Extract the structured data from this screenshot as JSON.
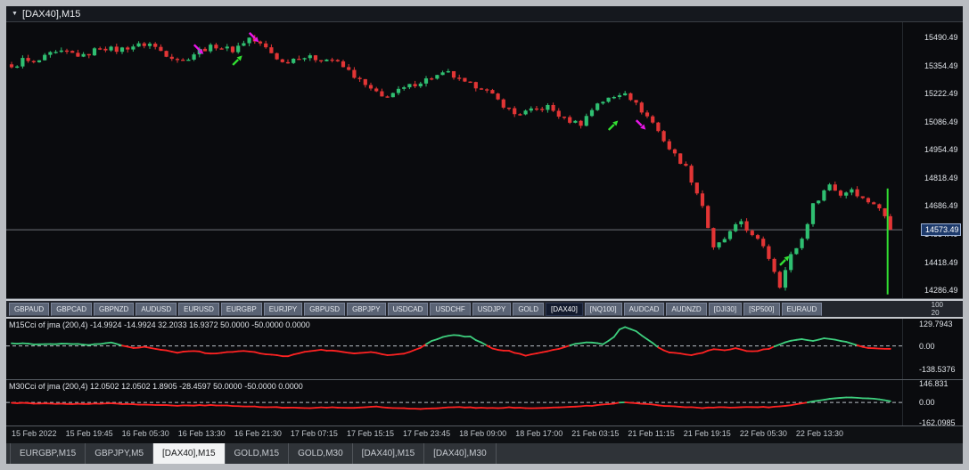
{
  "window": {
    "title": "[DAX40],M15"
  },
  "main_chart": {
    "price_labels": [
      "15490.49",
      "15354.49",
      "15222.49",
      "15086.49",
      "14954.49",
      "14818.49",
      "14686.49",
      "14554.49",
      "14418.49",
      "14286.49"
    ],
    "current_price": "14573.49"
  },
  "symbol_tabs": {
    "items": [
      "GBPAUD",
      "GBPCAD",
      "GBPNZD",
      "AUDUSD",
      "EURUSD",
      "EURGBP",
      "EURJPY",
      "GBPUSD",
      "GBPJPY",
      "USDCAD",
      "USDCHF",
      "USDJPY",
      "GOLD",
      "[DAX40]",
      "[NQ100]",
      "AUDCAD",
      "AUDNZD",
      "[DJI30]",
      "[SP500]",
      "EURAUD"
    ],
    "active": "[DAX40]",
    "right_labels": [
      "100",
      "20"
    ]
  },
  "indicator1": {
    "label": "M15Cci of jma (200,4) -14.9924 -14.9924 32.2033 16.9372 50.0000 -50.0000 0.0000",
    "axis": [
      "129.7943",
      "0.00",
      "-138.5376"
    ]
  },
  "indicator2": {
    "label": "M30Cci of jma (200,4) 12.0502 12.0502 1.8905 -28.4597 50.0000 -50.0000 0.0000",
    "axis": [
      "146.831",
      "0.00",
      "-162.0985"
    ]
  },
  "time_axis": {
    "labels": [
      "15 Feb 2022",
      "15 Feb 19:45",
      "16 Feb 05:30",
      "16 Feb 13:30",
      "16 Feb 21:30",
      "17 Feb 07:15",
      "17 Feb 15:15",
      "17 Feb 23:45",
      "18 Feb 09:00",
      "18 Feb 17:00",
      "21 Feb 03:15",
      "21 Feb 11:15",
      "21 Feb 19:15",
      "22 Feb 05:30",
      "22 Feb 13:30"
    ]
  },
  "bottom_tabs": {
    "items": [
      "EURGBP,M15",
      "GBPJPY,M5",
      "[DAX40],M15",
      "GOLD,M15",
      "GOLD,M30",
      "[DAX40],M15",
      "[DAX40],M30"
    ],
    "active_index": 2
  },
  "colors": {
    "candle_up": "#2fbf71",
    "candle_down": "#e23535",
    "arrow_up": "#32e032",
    "arrow_down": "#e816e8",
    "cci_up": "#3ecf7e",
    "cci_down": "#ff2222",
    "price_line": "#6f747a",
    "zero_line": "#b9bfc6"
  },
  "chart_data": {
    "type": "candlestick",
    "title": "[DAX40],M15",
    "main": {
      "num_candles": 160,
      "ylim": [
        14247,
        15563
      ],
      "current_price": 14573.49,
      "price_keypoints": [
        [
          0,
          15340
        ],
        [
          2,
          15385
        ],
        [
          4,
          15365
        ],
        [
          7,
          15410
        ],
        [
          10,
          15420
        ],
        [
          13,
          15400
        ],
        [
          16,
          15445
        ],
        [
          19,
          15430
        ],
        [
          22,
          15450
        ],
        [
          25,
          15460
        ],
        [
          28,
          15410
        ],
        [
          31,
          15380
        ],
        [
          34,
          15430
        ],
        [
          37,
          15450
        ],
        [
          40,
          15430
        ],
        [
          43,
          15488
        ],
        [
          46,
          15440
        ],
        [
          49,
          15370
        ],
        [
          52,
          15400
        ],
        [
          55,
          15390
        ],
        [
          58,
          15385
        ],
        [
          61,
          15330
        ],
        [
          64,
          15260
        ],
        [
          67,
          15205
        ],
        [
          70,
          15235
        ],
        [
          73,
          15270
        ],
        [
          76,
          15300
        ],
        [
          79,
          15320
        ],
        [
          82,
          15270
        ],
        [
          85,
          15255
        ],
        [
          88,
          15190
        ],
        [
          91,
          15125
        ],
        [
          94,
          15140
        ],
        [
          97,
          15160
        ],
        [
          100,
          15100
        ],
        [
          103,
          15080
        ],
        [
          106,
          15180
        ],
        [
          109,
          15205
        ],
        [
          111,
          15235
        ],
        [
          113,
          15170
        ],
        [
          116,
          15085
        ],
        [
          119,
          14960
        ],
        [
          122,
          14870
        ],
        [
          125,
          14690
        ],
        [
          127,
          14480
        ],
        [
          129,
          14530
        ],
        [
          132,
          14615
        ],
        [
          134,
          14540
        ],
        [
          136,
          14500
        ],
        [
          138,
          14380
        ],
        [
          139,
          14310
        ],
        [
          141,
          14450
        ],
        [
          143,
          14530
        ],
        [
          145,
          14690
        ],
        [
          147,
          14760
        ],
        [
          148,
          14790
        ],
        [
          150,
          14740
        ],
        [
          152,
          14770
        ],
        [
          154,
          14720
        ],
        [
          156,
          14700
        ],
        [
          158,
          14640
        ],
        [
          159,
          14573.49
        ]
      ],
      "arrows": [
        {
          "dir": "down",
          "index": 34,
          "price": 15430
        },
        {
          "dir": "up",
          "index": 41,
          "price": 15385
        },
        {
          "dir": "down",
          "index": 44,
          "price": 15487
        },
        {
          "dir": "up",
          "index": 109,
          "price": 15075
        },
        {
          "dir": "down",
          "index": 114,
          "price": 15070
        },
        {
          "dir": "up",
          "index": 140,
          "price": 14430
        }
      ],
      "vline": {
        "index": 158.5,
        "from": 14770,
        "to": 14265
      }
    },
    "cci_m15": {
      "range": [
        160,
        -195
      ],
      "keypoints": [
        [
          0,
          15
        ],
        [
          6,
          10
        ],
        [
          10,
          14
        ],
        [
          14,
          6
        ],
        [
          18,
          18
        ],
        [
          22,
          -12
        ],
        [
          24,
          -4
        ],
        [
          27,
          -22
        ],
        [
          30,
          -38
        ],
        [
          33,
          -28
        ],
        [
          36,
          -46
        ],
        [
          39,
          -38
        ],
        [
          42,
          -28
        ],
        [
          45,
          -42
        ],
        [
          48,
          -56
        ],
        [
          50,
          -60
        ],
        [
          53,
          -34
        ],
        [
          56,
          -24
        ],
        [
          59,
          -28
        ],
        [
          62,
          -44
        ],
        [
          65,
          -38
        ],
        [
          68,
          -52
        ],
        [
          71,
          -46
        ],
        [
          74,
          -10
        ],
        [
          76,
          30
        ],
        [
          78,
          52
        ],
        [
          80,
          62
        ],
        [
          83,
          54
        ],
        [
          85,
          18
        ],
        [
          87,
          -16
        ],
        [
          90,
          -30
        ],
        [
          93,
          -58
        ],
        [
          96,
          -38
        ],
        [
          99,
          -18
        ],
        [
          102,
          12
        ],
        [
          105,
          22
        ],
        [
          107,
          8
        ],
        [
          109,
          55
        ],
        [
          110,
          95
        ],
        [
          111,
          112
        ],
        [
          113,
          88
        ],
        [
          115,
          38
        ],
        [
          117,
          -8
        ],
        [
          119,
          -38
        ],
        [
          121,
          -44
        ],
        [
          123,
          -56
        ],
        [
          125,
          -38
        ],
        [
          127,
          -18
        ],
        [
          129,
          -26
        ],
        [
          131,
          -14
        ],
        [
          133,
          -30
        ],
        [
          135,
          -28
        ],
        [
          137,
          -16
        ],
        [
          139,
          8
        ],
        [
          141,
          32
        ],
        [
          143,
          42
        ],
        [
          145,
          30
        ],
        [
          147,
          46
        ],
        [
          149,
          36
        ],
        [
          151,
          22
        ],
        [
          153,
          4
        ],
        [
          155,
          -12
        ],
        [
          157,
          -16
        ],
        [
          159,
          -15
        ]
      ]
    },
    "cci_m30": {
      "range": [
        175,
        -180
      ],
      "keypoints": [
        [
          0,
          -4
        ],
        [
          6,
          -8
        ],
        [
          12,
          -12
        ],
        [
          18,
          -9
        ],
        [
          24,
          -16
        ],
        [
          30,
          -24
        ],
        [
          36,
          -21
        ],
        [
          42,
          -30
        ],
        [
          48,
          -38
        ],
        [
          54,
          -44
        ],
        [
          58,
          -37
        ],
        [
          62,
          -42
        ],
        [
          66,
          -34
        ],
        [
          70,
          -44
        ],
        [
          74,
          -50
        ],
        [
          78,
          -42
        ],
        [
          82,
          -37
        ],
        [
          86,
          -45
        ],
        [
          90,
          -39
        ],
        [
          94,
          -47
        ],
        [
          98,
          -41
        ],
        [
          102,
          -33
        ],
        [
          106,
          -22
        ],
        [
          109,
          -7
        ],
        [
          111,
          2
        ],
        [
          113,
          -4
        ],
        [
          116,
          -18
        ],
        [
          119,
          -28
        ],
        [
          122,
          -37
        ],
        [
          125,
          -42
        ],
        [
          128,
          -37
        ],
        [
          131,
          -40
        ],
        [
          134,
          -34
        ],
        [
          137,
          -37
        ],
        [
          140,
          -28
        ],
        [
          142,
          -12
        ],
        [
          144,
          2
        ],
        [
          146,
          16
        ],
        [
          148,
          28
        ],
        [
          150,
          36
        ],
        [
          152,
          38
        ],
        [
          154,
          35
        ],
        [
          156,
          29
        ],
        [
          158,
          19
        ],
        [
          159,
          12
        ]
      ]
    }
  }
}
